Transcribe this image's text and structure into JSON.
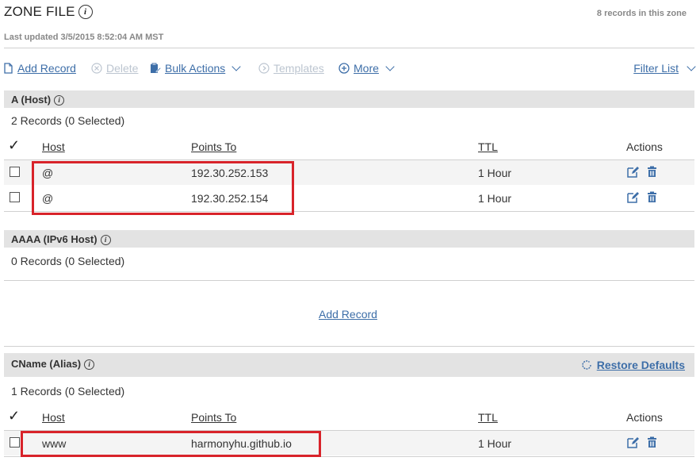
{
  "header": {
    "title": "ZONE FILE",
    "info_glyph": "i",
    "record_count": "8 records in this zone",
    "last_updated": "Last updated 3/5/2015 8:52:04 AM MST"
  },
  "toolbar": {
    "add_record": "Add Record",
    "delete": "Delete",
    "bulk_actions": "Bulk Actions",
    "templates": "Templates",
    "more": "More",
    "filter_list": "Filter List"
  },
  "sections": [
    {
      "title": "A (Host)",
      "records_summary": "2 Records (0 Selected)",
      "columns": [
        "Host",
        "Points To",
        "TTL",
        "Actions"
      ],
      "rows": [
        {
          "host": "@",
          "points_to": "192.30.252.153",
          "ttl": "1 Hour"
        },
        {
          "host": "@",
          "points_to": "192.30.252.154",
          "ttl": "1 Hour"
        }
      ]
    },
    {
      "title": "AAAA (IPv6 Host)",
      "records_summary": "0 Records (0 Selected)",
      "add_record": "Add Record"
    },
    {
      "title": "CName (Alias)",
      "restore_defaults": "Restore Defaults",
      "records_summary": "1 Records (0 Selected)",
      "columns": [
        "Host",
        "Points To",
        "TTL",
        "Actions"
      ],
      "rows": [
        {
          "host": "www",
          "points_to": "harmonyhu.github.io",
          "ttl": "1 Hour"
        }
      ]
    }
  ],
  "colors": {
    "link": "#3d6ea8",
    "highlight": "#d8232a",
    "section_bg": "#e3e3e3"
  }
}
